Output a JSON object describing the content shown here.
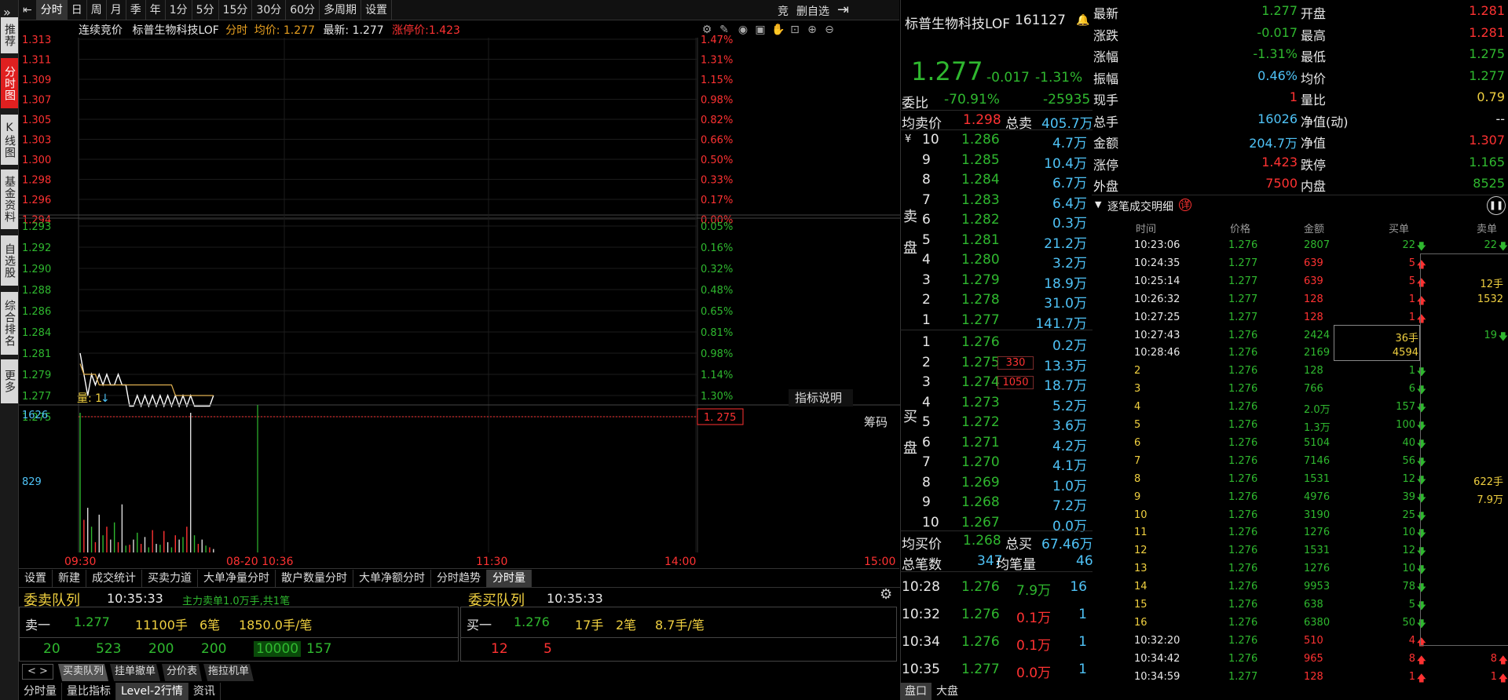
{
  "leftbar": [
    {
      "label": "推荐",
      "active": false
    },
    {
      "label": "分时图",
      "active": true
    },
    {
      "label": "K线图",
      "active": false
    },
    {
      "label": "基金资料",
      "active": false
    },
    {
      "label": "自选股",
      "active": false
    },
    {
      "label": "综合排名",
      "active": false
    },
    {
      "label": "更多",
      "active": false
    }
  ],
  "leftbar_arrow": "»",
  "toptabs": [
    "分时",
    "日",
    "周",
    "月",
    "季",
    "年",
    "1分",
    "5分",
    "15分",
    "30分",
    "60分",
    "多周期",
    "设置"
  ],
  "top_right": {
    "bid_label": "竞",
    "remove_label": "删自选"
  },
  "chart_info": {
    "auction": "连续竞价",
    "name": "标普生物科技LOF",
    "mode": "分时",
    "avg_label": "均价: 1.277",
    "latest_label": "最新: 1.277",
    "limit_label": "涨停价:1.423"
  },
  "chart_data": {
    "type": "line",
    "price_ticks_upper": [
      "1.313",
      "1.311",
      "1.309",
      "1.307",
      "1.305",
      "1.303",
      "1.300",
      "1.298",
      "1.296",
      "1.294"
    ],
    "pct_ticks_upper": [
      "1.47%",
      "1.31%",
      "1.15%",
      "0.98%",
      "0.82%",
      "0.66%",
      "0.50%",
      "0.33%",
      "0.17%",
      "0.00%"
    ],
    "price_ticks_lower": [
      "1.293",
      "1.292",
      "1.290",
      "1.288",
      "1.286",
      "1.284",
      "1.281",
      "1.279",
      "1.277",
      "1.275"
    ],
    "pct_ticks_lower": [
      "0.05%",
      "0.16%",
      "0.32%",
      "0.48%",
      "0.65%",
      "0.81%",
      "0.98%",
      "1.14%",
      "1.30%",
      "1.47%"
    ],
    "current_price_tag": "1. 275",
    "x_labels": [
      "09:30",
      "08-20 10:36",
      "11:30",
      "14:00",
      "15:00"
    ],
    "volume_label": "量: 1",
    "volume_ticks": [
      "1626",
      "829"
    ],
    "indicator_btn": "指标说明",
    "chips_btn": "筹码",
    "price_series": [
      1.281,
      1.279,
      1.277,
      1.279,
      1.278,
      1.279,
      1.278,
      1.279,
      1.278,
      1.278,
      1.279,
      1.278,
      1.278,
      1.276,
      1.276,
      1.277,
      1.276,
      1.277,
      1.276,
      1.277,
      1.276,
      1.277,
      1.276,
      1.277,
      1.276,
      1.277,
      1.276,
      1.277,
      1.276,
      1.277,
      1.276,
      1.276,
      1.276,
      1.276,
      1.276,
      1.277
    ],
    "avg_series": [
      1.28,
      1.279,
      1.279,
      1.279,
      1.279,
      1.278,
      1.278,
      1.278,
      1.278,
      1.278,
      1.278,
      1.278,
      1.278,
      1.278,
      1.278,
      1.278,
      1.278,
      1.278,
      1.278,
      1.278,
      1.278,
      1.278,
      1.278,
      1.278,
      1.278,
      1.277,
      1.277,
      1.277,
      1.277,
      1.277,
      1.277,
      1.277,
      1.277,
      1.277,
      1.277,
      1.277
    ],
    "volumes": [
      1626,
      380,
      520,
      300,
      120,
      440,
      200,
      300,
      150,
      350,
      120,
      560,
      80,
      90,
      150,
      230,
      100,
      180,
      60,
      260,
      100,
      90,
      250,
      120,
      60,
      200,
      150,
      180,
      300,
      1626,
      200,
      100,
      150,
      80,
      60,
      40
    ]
  },
  "tabbar2": [
    "设置",
    "新建",
    "成交统计",
    "买卖力道",
    "大单净量分时",
    "散户数量分时",
    "大单净额分时",
    "分时趋势",
    "分时量"
  ],
  "queue": {
    "sell_title": "委卖队列",
    "sell_time": "10:35:33",
    "sell_note": "主力卖单1.0万手,共1笔",
    "sell_row_label": "卖一",
    "sell_price": "1.277",
    "sell_qty": "11100手",
    "sell_count": "6笔",
    "sell_avg": "1850.0手/笔",
    "sell_items": [
      "20",
      "523",
      "200",
      "200",
      "10000",
      "157"
    ],
    "buy_title": "委买队列",
    "buy_time": "10:35:33",
    "buy_row_label": "买一",
    "buy_price": "1.276",
    "buy_qty": "17手",
    "buy_count": "2笔",
    "buy_avg": "8.7手/笔",
    "buy_items": [
      "12",
      "5"
    ]
  },
  "tabbar3": [
    "买卖队列",
    "挂单撤单",
    "分价表",
    "拖拉机单"
  ],
  "bottomtabs": [
    "分时量",
    "量比指标",
    "Level-2行情",
    "资讯"
  ],
  "stock": {
    "name": "标普生物科技LOF",
    "code": "161127",
    "price": "1.277",
    "change": "-0.017",
    "pct": "-1.31%",
    "weibi_label": "委比",
    "weibi": "-70.91%",
    "weicha": "-25935",
    "avg_ask_label": "均卖价",
    "avg_ask": "1.298",
    "total_ask_label": "总卖",
    "total_ask": "405.7万",
    "avg_bid_label": "均买价",
    "avg_bid": "1.268",
    "total_bid_label": "总买",
    "total_bid": "67.46万",
    "total_trades_label": "总笔数",
    "total_trades": "347",
    "avg_vol_label": "均笔量",
    "avg_vol": "46",
    "sell_side_label": "卖盘",
    "buy_side_label": "买盘",
    "yen": "¥"
  },
  "asks": [
    {
      "n": "10",
      "p": "1.286",
      "v": "4.7万"
    },
    {
      "n": "9",
      "p": "1.285",
      "v": "10.4万"
    },
    {
      "n": "8",
      "p": "1.284",
      "v": "6.7万"
    },
    {
      "n": "7",
      "p": "1.283",
      "v": "6.4万"
    },
    {
      "n": "6",
      "p": "1.282",
      "v": "0.3万"
    },
    {
      "n": "5",
      "p": "1.281",
      "v": "21.2万"
    },
    {
      "n": "4",
      "p": "1.280",
      "v": "3.2万"
    },
    {
      "n": "3",
      "p": "1.279",
      "v": "18.9万"
    },
    {
      "n": "2",
      "p": "1.278",
      "v": "31.0万"
    },
    {
      "n": "1",
      "p": "1.277",
      "v": "141.7万"
    }
  ],
  "bids": [
    {
      "n": "1",
      "p": "1.276",
      "v": "0.2万",
      "tag": ""
    },
    {
      "n": "2",
      "p": "1.275",
      "v": "13.3万",
      "tag": "330"
    },
    {
      "n": "3",
      "p": "1.274",
      "v": "18.7万",
      "tag": "1050"
    },
    {
      "n": "4",
      "p": "1.273",
      "v": "5.2万",
      "tag": ""
    },
    {
      "n": "5",
      "p": "1.272",
      "v": "3.6万",
      "tag": ""
    },
    {
      "n": "6",
      "p": "1.271",
      "v": "4.2万",
      "tag": ""
    },
    {
      "n": "7",
      "p": "1.270",
      "v": "4.1万",
      "tag": ""
    },
    {
      "n": "8",
      "p": "1.269",
      "v": "1.0万",
      "tag": ""
    },
    {
      "n": "9",
      "p": "1.268",
      "v": "7.2万",
      "tag": ""
    },
    {
      "n": "10",
      "p": "1.267",
      "v": "0.0万",
      "tag": ""
    }
  ],
  "recent": [
    {
      "t": "10:28",
      "p": "1.276",
      "v": "7.9万",
      "n": "16",
      "vc": "green"
    },
    {
      "t": "10:32",
      "p": "1.276",
      "v": "0.1万",
      "n": "1",
      "vc": "red"
    },
    {
      "t": "10:34",
      "p": "1.276",
      "v": "0.1万",
      "n": "1",
      "vc": "red"
    },
    {
      "t": "10:35",
      "p": "1.277",
      "v": "0.0万",
      "n": "1",
      "vc": "red"
    }
  ],
  "bottom_right_tabs": [
    "盘口",
    "大盘"
  ],
  "quote": [
    {
      "l": "最新",
      "v": "1.277",
      "c": "green",
      "l2": "开盘",
      "v2": "1.281",
      "c2": "red"
    },
    {
      "l": "涨跌",
      "v": "-0.017",
      "c": "green",
      "l2": "最高",
      "v2": "1.281",
      "c2": "red"
    },
    {
      "l": "涨幅",
      "v": "-1.31%",
      "c": "green",
      "l2": "最低",
      "v2": "1.275",
      "c2": "green"
    },
    {
      "l": "振幅",
      "v": "0.46%",
      "c": "cyan",
      "l2": "均价",
      "v2": "1.277",
      "c2": "green"
    },
    {
      "l": "现手",
      "v": "1",
      "c": "red",
      "l2": "量比",
      "v2": "0.79",
      "c2": "yellow"
    },
    {
      "l": "总手",
      "v": "16026",
      "c": "cyan",
      "l2": "净值(动)",
      "v2": "--",
      "c2": "white"
    },
    {
      "l": "金额",
      "v": "204.7万",
      "c": "cyan",
      "l2": "净值",
      "v2": "1.307",
      "c2": "red"
    },
    {
      "l": "涨停",
      "v": "1.423",
      "c": "red",
      "l2": "跌停",
      "v2": "1.165",
      "c2": "green"
    },
    {
      "l": "外盘",
      "v": "7500",
      "c": "red",
      "l2": "内盘",
      "v2": "8525",
      "c2": "green"
    }
  ],
  "ticks_title": "逐笔成交明细",
  "ticks_badge": "详",
  "ticks_headers": [
    "时间",
    "价格",
    "金额",
    "买单",
    "卖单"
  ],
  "ticks": [
    {
      "t": "10:23:06",
      "p": "1.276",
      "a": "2807",
      "b": "22",
      "bd": "down",
      "s": "22",
      "sd": "down"
    },
    {
      "t": "10:24:35",
      "p": "1.277",
      "a": "639",
      "b": "5",
      "bd": "up",
      "s": "",
      "sd": ""
    },
    {
      "t": "10:25:14",
      "p": "1.277",
      "a": "639",
      "b": "5",
      "bd": "up",
      "s": "12手",
      "sd": ""
    },
    {
      "t": "10:26:32",
      "p": "1.277",
      "a": "128",
      "b": "1",
      "bd": "up",
      "s": "1532",
      "sd": ""
    },
    {
      "t": "10:27:25",
      "p": "1.277",
      "a": "128",
      "b": "1",
      "bd": "up",
      "s": "",
      "sd": ""
    },
    {
      "t": "10:27:43",
      "p": "1.276",
      "a": "2424",
      "b": "36手",
      "bd": "",
      "s": "19",
      "sd": "down"
    },
    {
      "t": "10:28:46",
      "p": "1.276",
      "a": "2169",
      "b": "4594",
      "bd": "",
      "s": "",
      "sd": ""
    },
    {
      "t": "2",
      "p": "1.276",
      "a": "128",
      "b": "1",
      "bd": "down",
      "s": "",
      "sd": ""
    },
    {
      "t": "3",
      "p": "1.276",
      "a": "766",
      "b": "6",
      "bd": "down",
      "s": "",
      "sd": ""
    },
    {
      "t": "4",
      "p": "1.276",
      "a": "2.0万",
      "b": "157",
      "bd": "down",
      "s": "",
      "sd": ""
    },
    {
      "t": "5",
      "p": "1.276",
      "a": "1.3万",
      "b": "100",
      "bd": "down",
      "s": "",
      "sd": ""
    },
    {
      "t": "6",
      "p": "1.276",
      "a": "5104",
      "b": "40",
      "bd": "down",
      "s": "",
      "sd": ""
    },
    {
      "t": "7",
      "p": "1.276",
      "a": "7146",
      "b": "56",
      "bd": "down",
      "s": "",
      "sd": ""
    },
    {
      "t": "8",
      "p": "1.276",
      "a": "1531",
      "b": "12",
      "bd": "down",
      "s": "622手",
      "sd": ""
    },
    {
      "t": "9",
      "p": "1.276",
      "a": "4976",
      "b": "39",
      "bd": "down",
      "s": "7.9万",
      "sd": ""
    },
    {
      "t": "10",
      "p": "1.276",
      "a": "3190",
      "b": "25",
      "bd": "down",
      "s": "",
      "sd": ""
    },
    {
      "t": "11",
      "p": "1.276",
      "a": "1276",
      "b": "10",
      "bd": "down",
      "s": "",
      "sd": ""
    },
    {
      "t": "12",
      "p": "1.276",
      "a": "1531",
      "b": "12",
      "bd": "down",
      "s": "",
      "sd": ""
    },
    {
      "t": "13",
      "p": "1.276",
      "a": "1276",
      "b": "10",
      "bd": "down",
      "s": "",
      "sd": ""
    },
    {
      "t": "14",
      "p": "1.276",
      "a": "9953",
      "b": "78",
      "bd": "down",
      "s": "",
      "sd": ""
    },
    {
      "t": "15",
      "p": "1.276",
      "a": "638",
      "b": "5",
      "bd": "down",
      "s": "",
      "sd": ""
    },
    {
      "t": "16",
      "p": "1.276",
      "a": "6380",
      "b": "50",
      "bd": "down",
      "s": "",
      "sd": ""
    },
    {
      "t": "10:32:20",
      "p": "1.276",
      "a": "510",
      "b": "4",
      "bd": "up",
      "s": "",
      "sd": ""
    },
    {
      "t": "10:34:42",
      "p": "1.276",
      "a": "965",
      "b": "8",
      "bd": "up",
      "s": "8",
      "sd": "up"
    },
    {
      "t": "10:34:59",
      "p": "1.277",
      "a": "128",
      "b": "1",
      "bd": "up",
      "s": "1",
      "sd": "up"
    }
  ]
}
